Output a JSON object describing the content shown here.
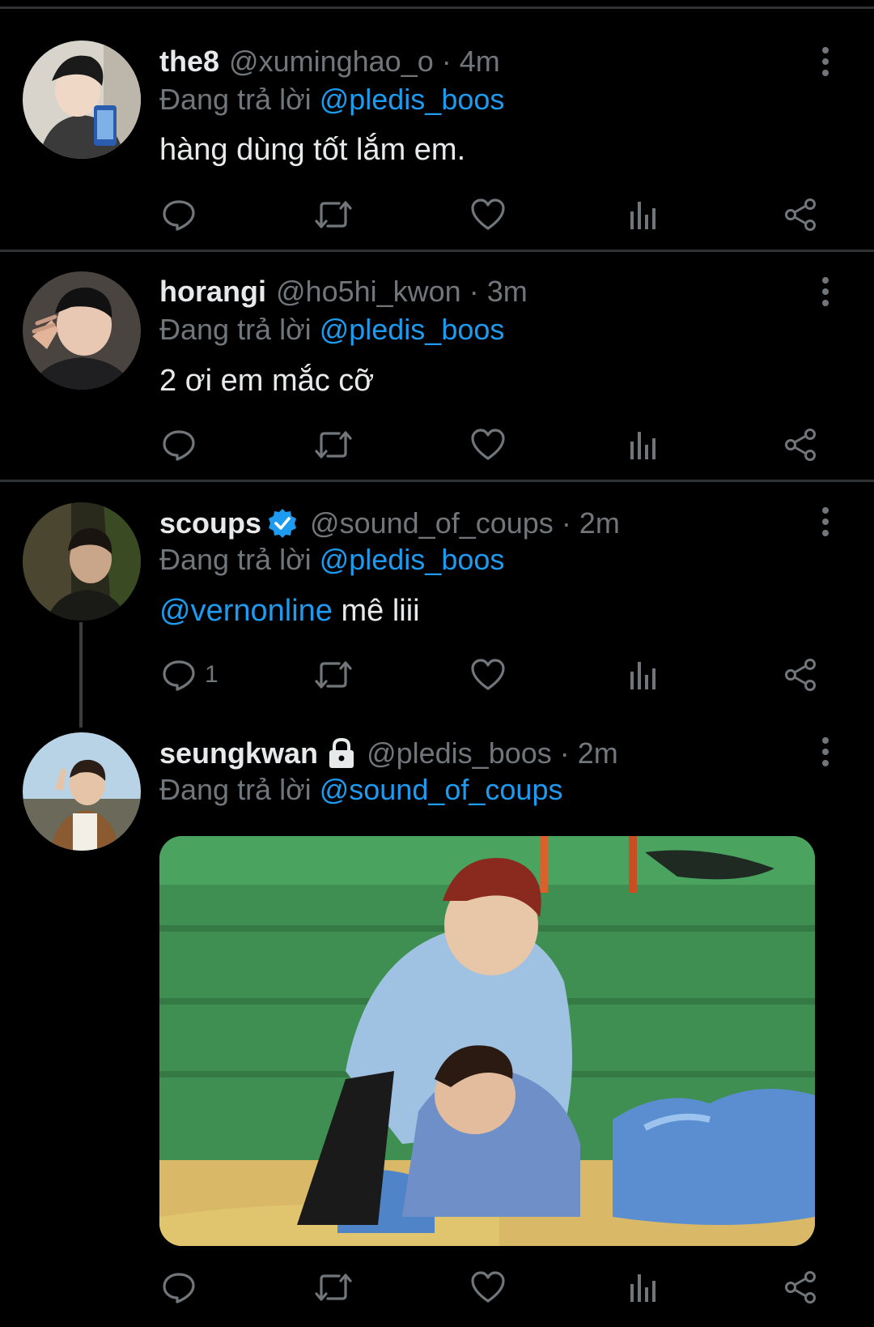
{
  "replying_label": "Đang trả lời",
  "tweets": [
    {
      "name": "the8",
      "handle": "@xuminghao_o",
      "time": "· 4m",
      "reply_to": "@pledis_boos",
      "text": "hàng dùng tốt lắm em.",
      "reply_count": ""
    },
    {
      "name": "horangi",
      "handle": "@ho5hi_kwon",
      "time": "· 3m",
      "reply_to": "@pledis_boos",
      "text": "2 ơi em mắc cỡ",
      "reply_count": ""
    },
    {
      "name": "scoups",
      "verified": true,
      "handle": "@sound_of_coups",
      "time": "· 2m",
      "reply_to": "@pledis_boos",
      "text_mention": "@vernonline",
      "text": " mê liii",
      "reply_count": "1"
    },
    {
      "name": "seungkwan",
      "protected": true,
      "handle": "@pledis_boos",
      "time": "· 2m",
      "reply_to": "@sound_of_coups",
      "has_media": true,
      "reply_count": ""
    }
  ],
  "icons": {
    "reply": "reply-icon",
    "retweet": "retweet-icon",
    "like": "heart-icon",
    "views": "views-icon",
    "share": "share-icon",
    "more": "more-vertical-icon",
    "verified": "verified-badge-icon",
    "lock": "lock-icon"
  },
  "colors": {
    "background": "#000000",
    "text": "#e7e9ea",
    "muted": "#71767b",
    "link": "#1d9bf0",
    "divider": "#2f3336"
  }
}
